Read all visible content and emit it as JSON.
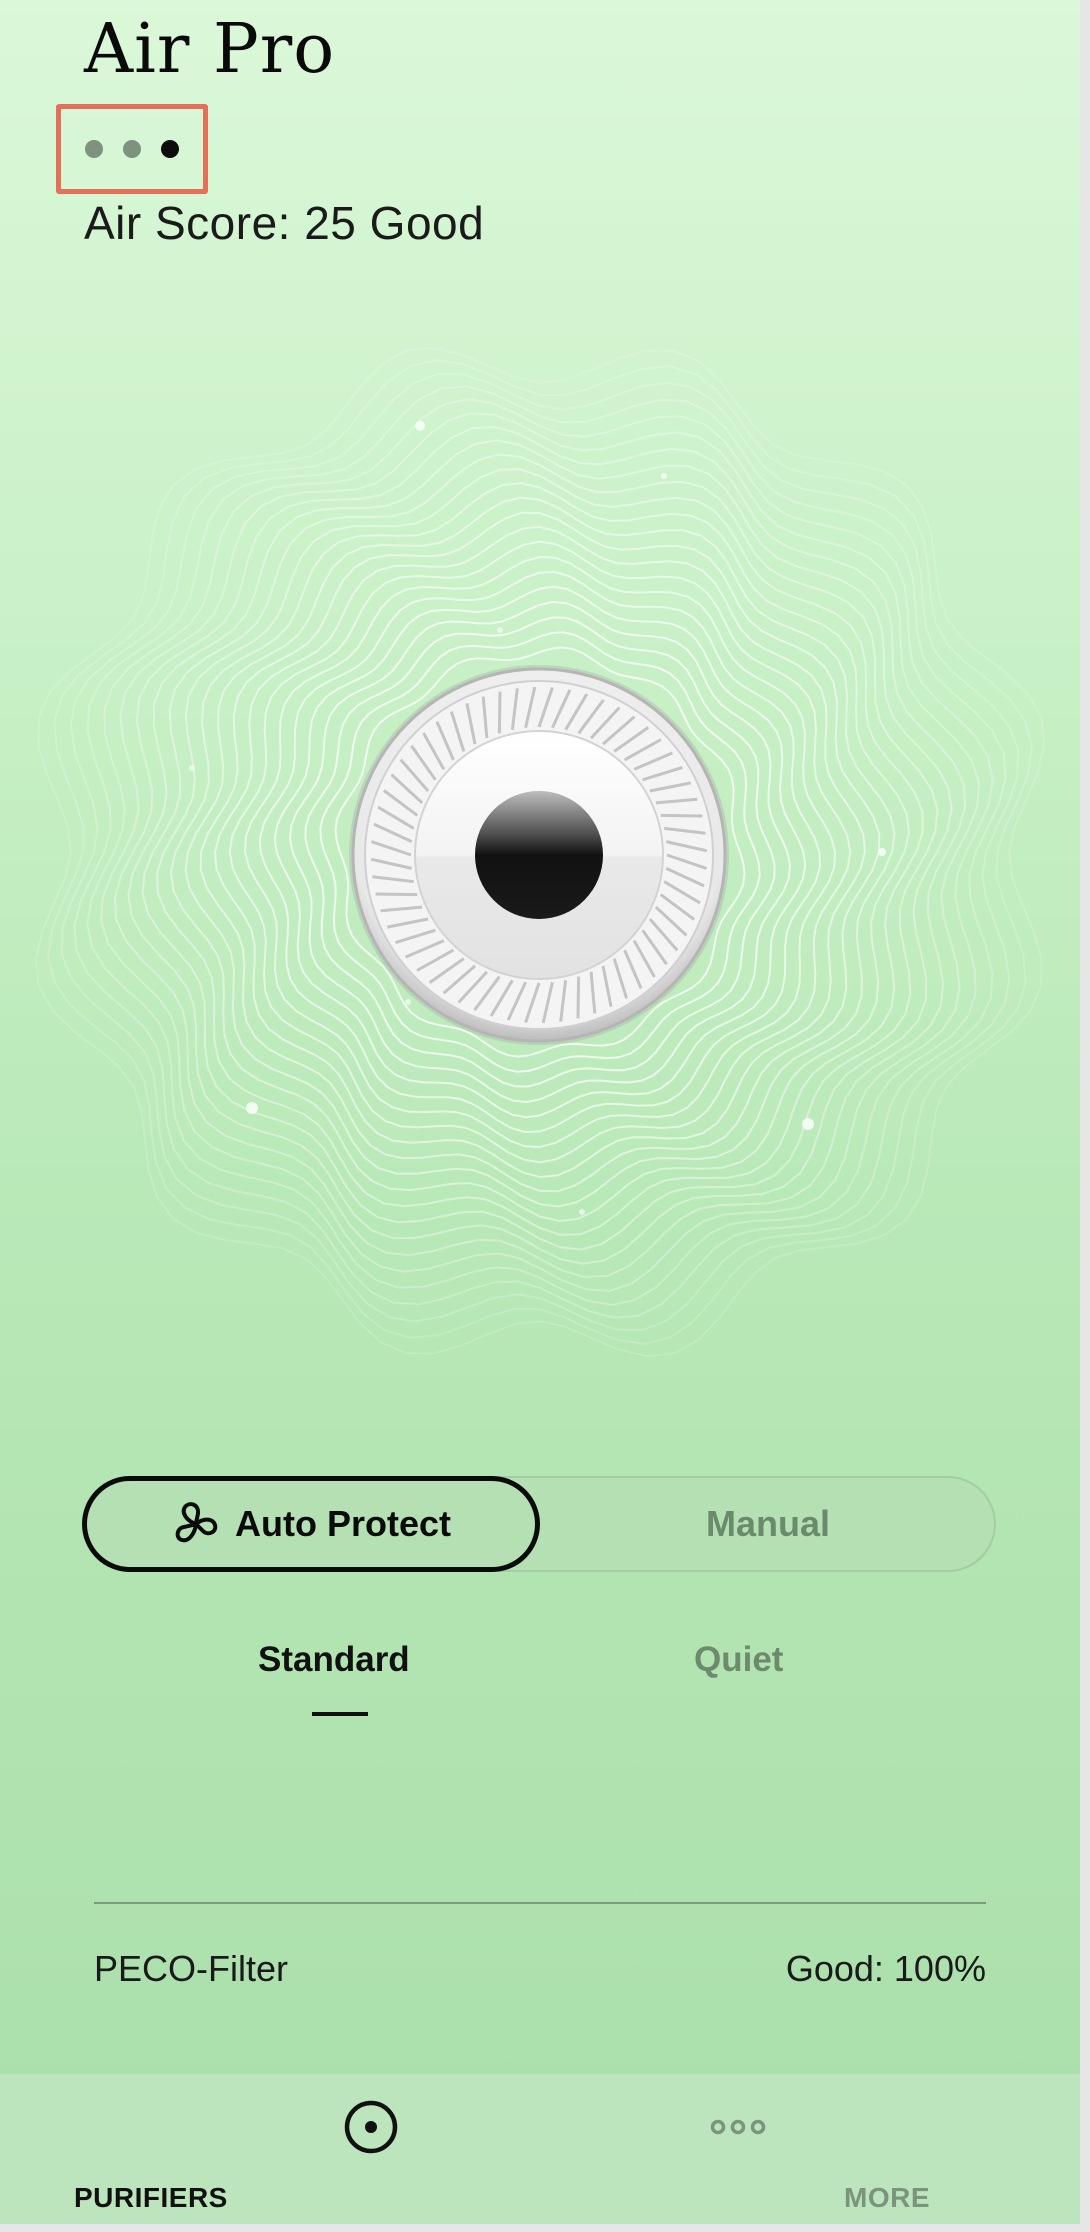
{
  "device": {
    "name": "Air Pro",
    "pager": {
      "count": 3,
      "active_index": 2
    }
  },
  "air_score": {
    "text": "Air Score: 25 Good"
  },
  "modes": {
    "auto_label": "Auto Protect",
    "manual_label": "Manual",
    "selected": "Auto Protect"
  },
  "speed": {
    "standard_label": "Standard",
    "quiet_label": "Quiet",
    "selected": "Standard"
  },
  "filter": {
    "name": "PECO-Filter",
    "status": "Good: 100%"
  },
  "nav": {
    "purifiers_label": "PURIFIERS",
    "more_label": "MORE",
    "active": "PURIFIERS"
  },
  "icons": {
    "pager": "page-indicator-dots",
    "auto": "fan-blades-icon",
    "purifiers": "purifier-target-icon",
    "more": "more-dots-icon"
  },
  "colors": {
    "accent_outline": "#e4705a",
    "text_primary": "#0b0b0b",
    "inactive": "#6a8a6b"
  }
}
